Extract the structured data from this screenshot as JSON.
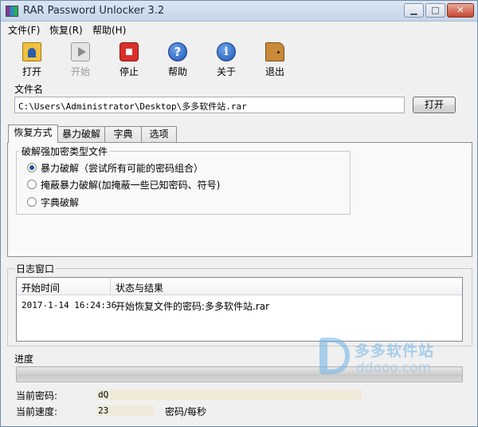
{
  "window": {
    "title": "RAR Password Unlocker 3.2"
  },
  "menu": [
    "文件(F)",
    "恢复(R)",
    "帮助(H)"
  ],
  "toolbar": [
    {
      "label": "打开",
      "icon": "folder-open-icon",
      "enabled": true
    },
    {
      "label": "开始",
      "icon": "play-icon",
      "enabled": false
    },
    {
      "label": "停止",
      "icon": "stop-icon",
      "enabled": true
    },
    {
      "label": "帮助",
      "icon": "help-icon",
      "enabled": true
    },
    {
      "label": "关于",
      "icon": "info-icon",
      "enabled": true
    },
    {
      "label": "退出",
      "icon": "door-exit-icon",
      "enabled": true
    }
  ],
  "file": {
    "group_label": "文件名",
    "path": "C:\\Users\\Administrator\\Desktop\\多多软件站.rar",
    "open_button": "打开"
  },
  "tabs": [
    "恢复方式",
    "暴力破解",
    "字典",
    "选项"
  ],
  "recovery": {
    "group_label": "破解强加密类型文件",
    "options": [
      {
        "label": "暴力破解（尝试所有可能的密码组合）",
        "checked": true
      },
      {
        "label": "掩蔽暴力破解(加掩蔽一些已知密码、符号)",
        "checked": false
      },
      {
        "label": "字典破解",
        "checked": false
      }
    ]
  },
  "log": {
    "group_label": "日志窗口",
    "columns": [
      "开始时间",
      "状态与结果"
    ],
    "rows": [
      {
        "time": "2017-1-14 16:24:36",
        "status": "开始恢复文件的密码:多多软件站.rar"
      }
    ]
  },
  "progress": {
    "label": "进度",
    "value": 0
  },
  "current": {
    "password_label": "当前密码:",
    "password_value": "dQ",
    "speed_label": "当前速度:",
    "speed_value": "23",
    "speed_unit": "密码/每秒"
  },
  "watermark": {
    "name": "多多软件站",
    "url": "ddooo.com"
  },
  "colors": {
    "accent": "#1e57b8",
    "progress": "#3cb43c",
    "stop": "#d8302a"
  }
}
